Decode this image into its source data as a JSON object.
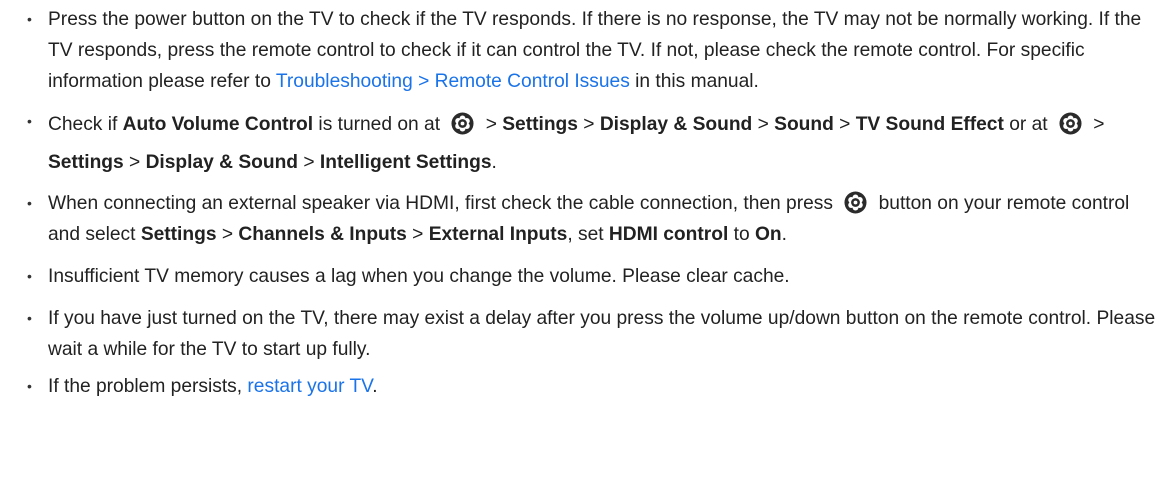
{
  "bullet_char": "•",
  "icon": "settings-gear-icon",
  "colors": {
    "text": "#222222",
    "link": "#1a73e8",
    "icon_fill": "#2b2b2b"
  },
  "items": [
    {
      "t1": "Press the power button on the TV to check if the TV responds. If there is no response, the TV may not be normally working. If the TV responds, press the remote control to check if it can control the TV. If not, please check the remote control. For specific information please refer to ",
      "link": "Troubleshooting > Remote Control Issues",
      "t2": " in this manual."
    },
    {
      "t1": "Check if ",
      "b1": "Auto Volume Control",
      "t2": " is turned on at ",
      "t3": " > ",
      "b2": "Settings",
      "t4": " > ",
      "b3": "Display & Sound",
      "t5": " > ",
      "b4": "Sound",
      "t6": " > ",
      "b5": "TV Sound Effect",
      "t7": " or at ",
      "t8": " > ",
      "b6": "Settings",
      "t9": " > ",
      "b7": "Display & Sound",
      "t10": " > ",
      "b8": "Intelligent Settings",
      "t11": "."
    },
    {
      "t1": "When connecting an external speaker via HDMI, first check the cable connection, then press ",
      "t2": " button on your remote control and select ",
      "b1": "Settings",
      "t3": " > ",
      "b2": "Channels & Inputs",
      "t4": " > ",
      "b3": "External Inputs",
      "t5": ", set ",
      "b4": "HDMI control",
      "t6": " to ",
      "b5": "On",
      "t7": "."
    },
    {
      "t1": "Insufficient TV memory causes a lag when you change the volume. Please clear cache."
    },
    {
      "t1": "If you have just turned on the TV, there may exist a delay after you press the volume up/down button on the remote control. Please wait a while for the TV to start up fully."
    },
    {
      "t1": "If the problem persists, ",
      "link": "restart your TV",
      "t2": "."
    }
  ]
}
